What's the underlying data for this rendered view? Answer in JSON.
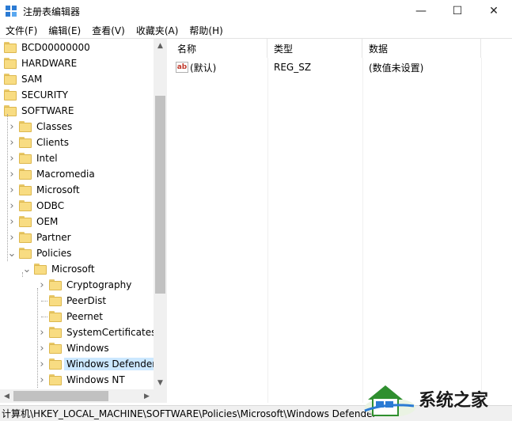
{
  "window": {
    "title": "注册表编辑器",
    "minimize_glyph": "—",
    "maximize_glyph": "☐",
    "close_glyph": "✕"
  },
  "menu": [
    "文件(F)",
    "编辑(E)",
    "查看(V)",
    "收藏夹(A)",
    "帮助(H)"
  ],
  "tree": {
    "items": [
      {
        "label": "BCD00000000",
        "depth": 0,
        "expander": "none"
      },
      {
        "label": "HARDWARE",
        "depth": 0,
        "expander": "none"
      },
      {
        "label": "SAM",
        "depth": 0,
        "expander": "none"
      },
      {
        "label": "SECURITY",
        "depth": 0,
        "expander": "none"
      },
      {
        "label": "SOFTWARE",
        "depth": 0,
        "expander": "none"
      },
      {
        "label": "Classes",
        "depth": 1,
        "expander": "collapsed"
      },
      {
        "label": "Clients",
        "depth": 1,
        "expander": "collapsed"
      },
      {
        "label": "Intel",
        "depth": 1,
        "expander": "collapsed"
      },
      {
        "label": "Macromedia",
        "depth": 1,
        "expander": "collapsed"
      },
      {
        "label": "Microsoft",
        "depth": 1,
        "expander": "collapsed"
      },
      {
        "label": "ODBC",
        "depth": 1,
        "expander": "collapsed"
      },
      {
        "label": "OEM",
        "depth": 1,
        "expander": "collapsed"
      },
      {
        "label": "Partner",
        "depth": 1,
        "expander": "collapsed"
      },
      {
        "label": "Policies",
        "depth": 1,
        "expander": "expanded"
      },
      {
        "label": "Microsoft",
        "depth": 2,
        "expander": "expanded"
      },
      {
        "label": "Cryptography",
        "depth": 3,
        "expander": "collapsed"
      },
      {
        "label": "PeerDist",
        "depth": 3,
        "expander": "none"
      },
      {
        "label": "Peernet",
        "depth": 3,
        "expander": "none"
      },
      {
        "label": "SystemCertificates",
        "depth": 3,
        "expander": "collapsed"
      },
      {
        "label": "Windows",
        "depth": 3,
        "expander": "collapsed"
      },
      {
        "label": "Windows Defender",
        "depth": 3,
        "expander": "collapsed",
        "selected": true
      },
      {
        "label": "Windows NT",
        "depth": 3,
        "expander": "collapsed"
      }
    ]
  },
  "list": {
    "columns": {
      "name": "名称",
      "type": "类型",
      "data": "数据"
    },
    "rows": [
      {
        "name": "(默认)",
        "type": "REG_SZ",
        "data": "(数值未设置)",
        "icon": "ab-string-icon"
      }
    ]
  },
  "status_bar": "计算机\\HKEY_LOCAL_MACHINE\\SOFTWARE\\Policies\\Microsoft\\Windows Defender",
  "watermark": {
    "text": "系统之家"
  },
  "colors": {
    "selection": "#cce8ff",
    "folder": "#f8dc82",
    "scrollbar_thumb": "#c1c1c1"
  }
}
